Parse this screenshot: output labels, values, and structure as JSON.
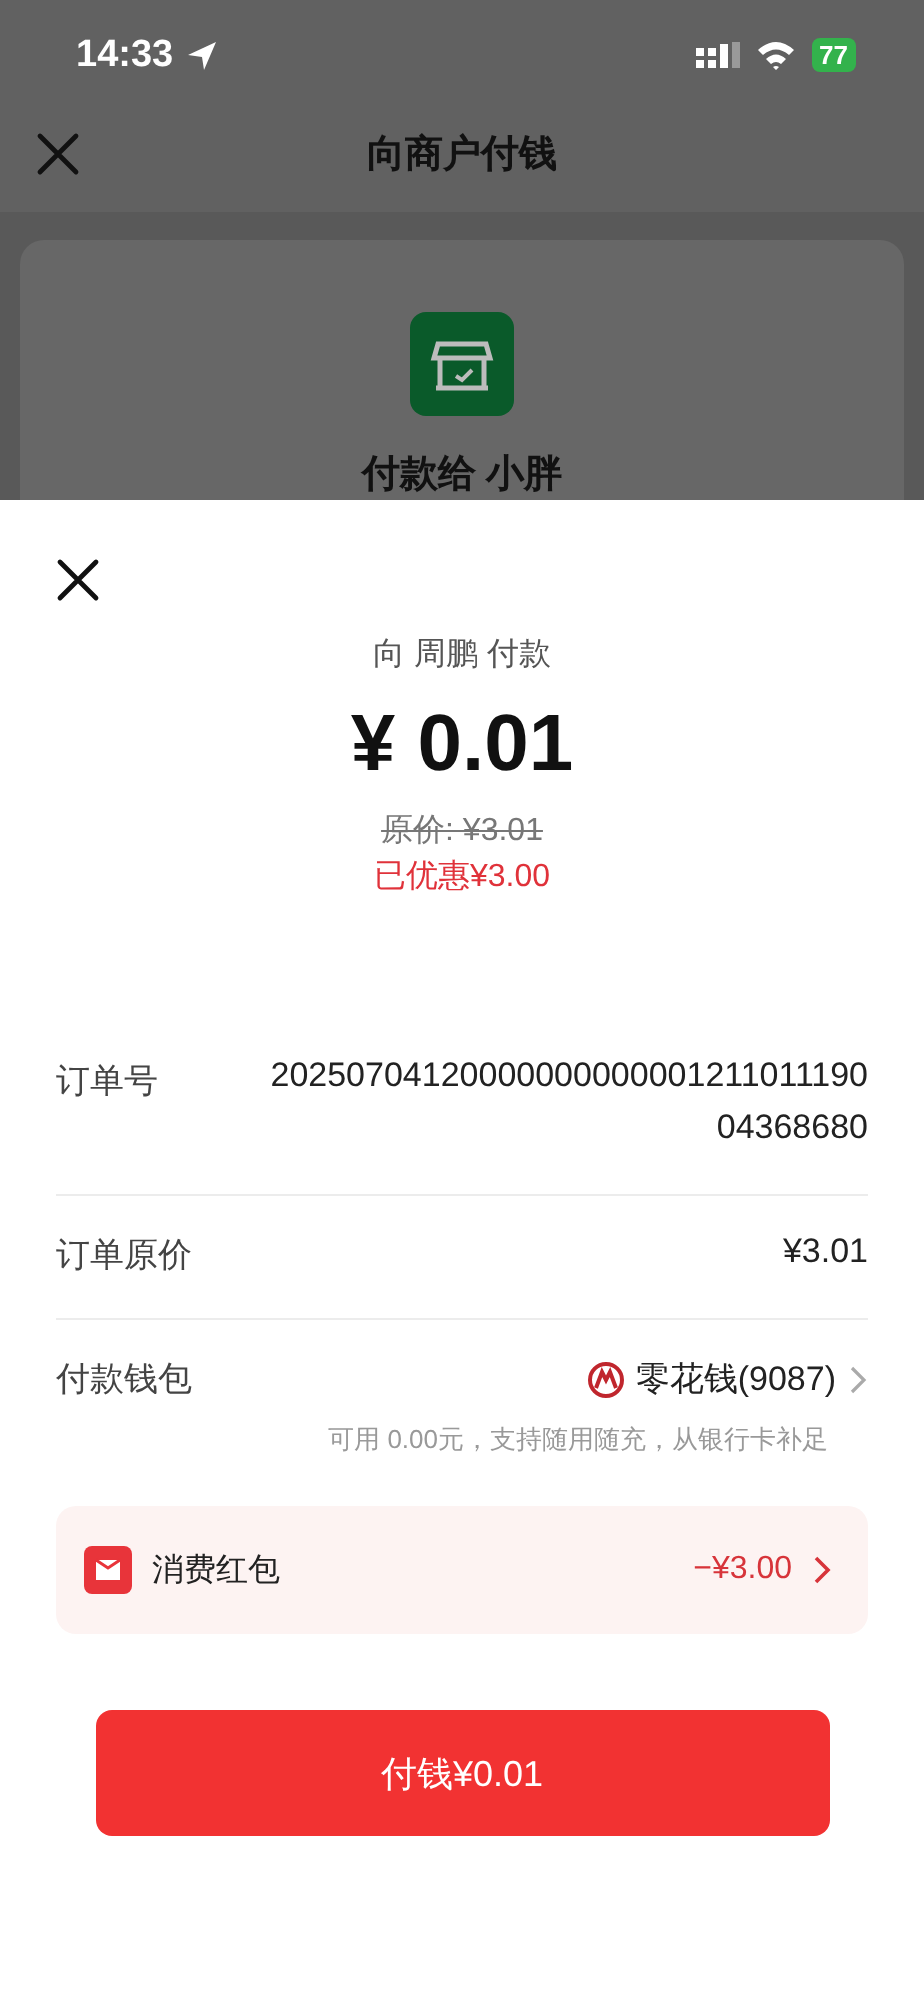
{
  "status_bar": {
    "time": "14:33",
    "battery": "77"
  },
  "background_page": {
    "title": "向商户付钱",
    "payee": "付款给 小胖"
  },
  "sheet": {
    "payee_line": "向 周鹏 付款",
    "amount": "¥ 0.01",
    "original_price": "原价: ¥3.01",
    "discount": "已优惠¥3.00",
    "rows": [
      {
        "kind": "plain",
        "label": "订单号",
        "value": "2025070412000000000000121101119004368680"
      },
      {
        "kind": "plain",
        "label": "订单原价",
        "value": "¥3.01"
      },
      {
        "kind": "wallet",
        "label": "付款钱包",
        "value": "零花钱(9087)",
        "note": "可用 0.00元，支持随用随充，从银行卡补足"
      }
    ],
    "coupon": {
      "label": "消费红包",
      "value": "−¥3.00"
    },
    "pay_button": "付钱¥0.01"
  }
}
